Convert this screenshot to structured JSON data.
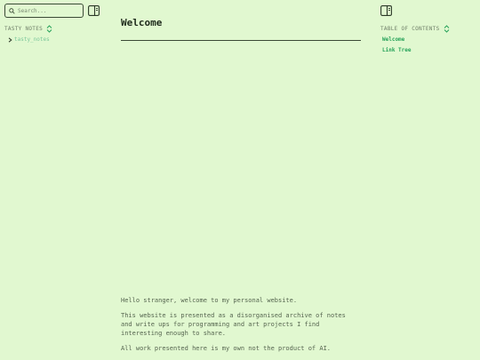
{
  "sidebar": {
    "search_placeholder": "Search...",
    "section_title": "TASTY NOTES",
    "tree": [
      {
        "label": "tasty_notes"
      }
    ]
  },
  "main": {
    "title": "Welcome",
    "paragraphs": [
      "Hello stranger, welcome to my personal website.",
      "This website is presented as a disorganised archive of notes and write ups for programming and art projects I find interesting enough to share.",
      "All work presented here is my own not the product of AI."
    ]
  },
  "toc": {
    "title": "TABLE OF CONTENTS",
    "items": [
      {
        "label": "Welcome"
      },
      {
        "label": "Link Tree"
      }
    ]
  },
  "colors": {
    "background": "#e1f8d0",
    "accent": "#27a35a",
    "text": "#55654f"
  }
}
